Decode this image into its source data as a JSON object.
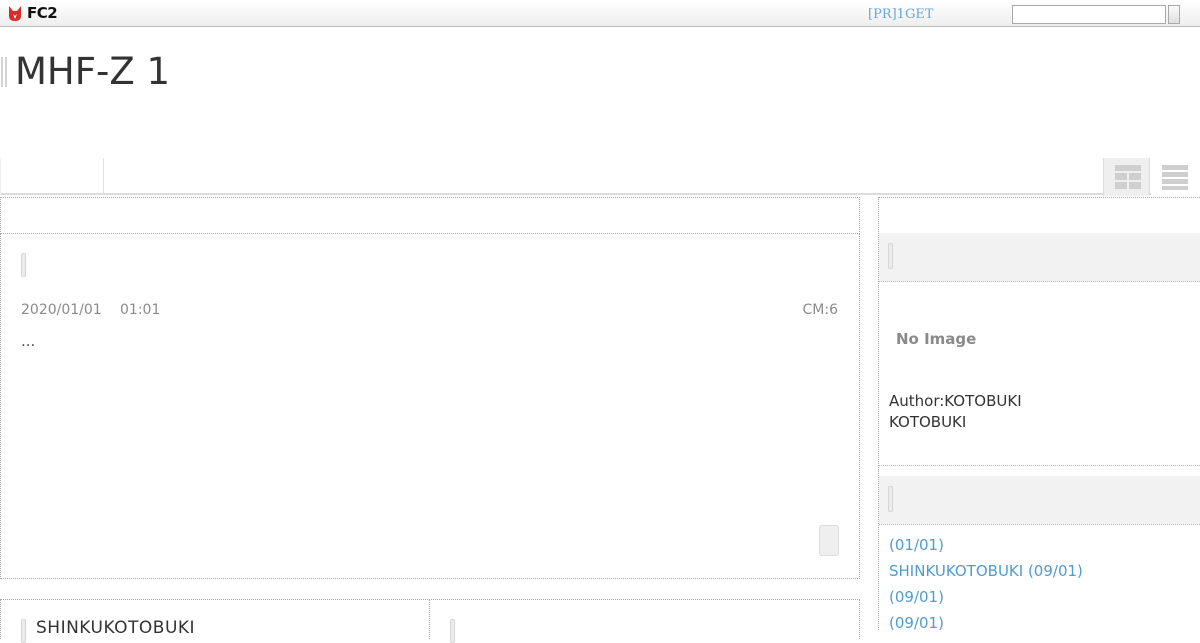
{
  "topbar": {
    "brand": "FC2",
    "pr_link": "[PR]1GET",
    "search": {
      "value": "",
      "placeholder": ""
    }
  },
  "blog": {
    "title": "MHF-Z 1"
  },
  "entry": {
    "date": "2020/01/01",
    "time": "01:01",
    "comments": "CM:6",
    "excerpt": "..."
  },
  "sub_entry": {
    "title": "SHINKUKOTOBUKI"
  },
  "profile": {
    "no_image": "No Image",
    "author_line": "Author:KOTOBUKI",
    "author_name": "KOTOBUKI"
  },
  "recent_entries": [
    {
      "label": " (01/01)"
    },
    {
      "label": "SHINKUKOTOBUKI (09/01)"
    },
    {
      "label": " (09/01)"
    },
    {
      "label": " (09/01)"
    }
  ],
  "colors": {
    "link": "#4f9ccd",
    "pr_link": "#6aa6d6",
    "brand_red": "#d62c2c",
    "meta_gray": "#8a8a8a"
  }
}
